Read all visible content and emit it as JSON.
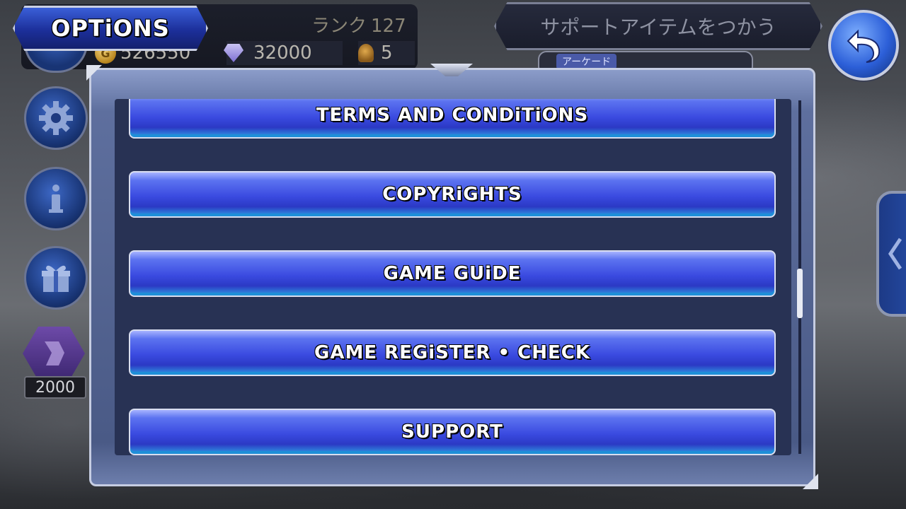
{
  "header": {
    "title": "OPTiONS",
    "rank_label": "ランク",
    "rank_value": "127",
    "support_item_label": "サポートアイテムをつかう",
    "arcade_tag": "アーケード"
  },
  "currency": {
    "gil": "526550",
    "gil_icon_letter": "G",
    "gems": "32000",
    "bells": "5"
  },
  "sidebar": {
    "drop_count": "2000"
  },
  "menu": {
    "items": [
      {
        "label": "TERMS AND CONDiTiONS"
      },
      {
        "label": "COPYRiGHTS"
      },
      {
        "label": "GAME GUiDE"
      },
      {
        "label": "GAME REGiSTER • CHECK"
      },
      {
        "label": "SUPPORT"
      }
    ]
  },
  "icons": [
    "gear-icon",
    "info-icon",
    "gift-icon",
    "back-arrow-icon",
    "chevron-left-icon",
    "gem-icon",
    "bell-icon",
    "coin-icon"
  ],
  "colors": {
    "button_blue": "#3a4ae0",
    "panel_frame": "#5e6f9e",
    "panel_inner": "#283254"
  }
}
